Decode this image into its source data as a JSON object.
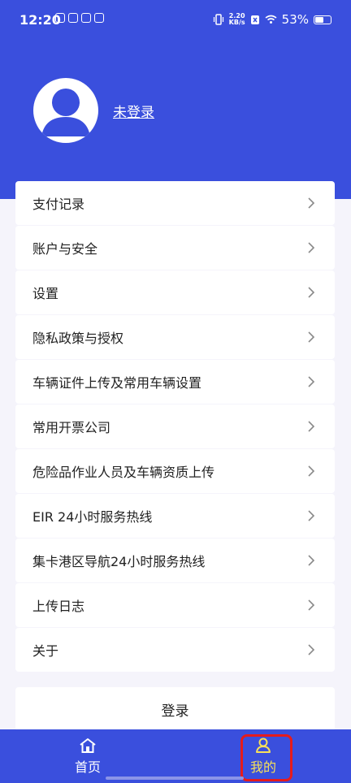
{
  "status_bar": {
    "time": "12:20",
    "network_speed_value": "2.20",
    "network_speed_unit": "KB/s",
    "battery": "53%"
  },
  "profile": {
    "login_link": "未登录"
  },
  "menu": {
    "items": [
      {
        "label": "支付记录"
      },
      {
        "label": "账户与安全"
      },
      {
        "label": "设置"
      },
      {
        "label": "隐私政策与授权"
      },
      {
        "label": "车辆证件上传及常用车辆设置"
      },
      {
        "label": "常用开票公司"
      },
      {
        "label": "危险品作业人员及车辆资质上传"
      },
      {
        "label": "EIR 24小时服务热线"
      },
      {
        "label": "集卡港区导航24小时服务热线"
      },
      {
        "label": "上传日志"
      },
      {
        "label": "关于"
      }
    ]
  },
  "login_button": "登录",
  "tabbar": {
    "home": {
      "label": "首页",
      "icon": "home-icon"
    },
    "mine": {
      "label": "我的",
      "icon": "person-icon"
    }
  },
  "colors": {
    "primary": "#3a4fdd",
    "active_tab": "#f7e05a",
    "highlight": "#e61b1b"
  }
}
